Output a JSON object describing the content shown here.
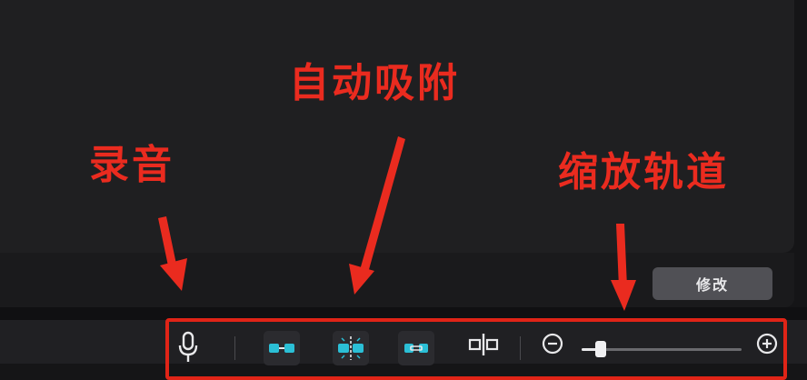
{
  "top_panel": {
    "edit_button_label": "修改"
  },
  "annotations": {
    "record": "录音",
    "auto_snap": "自动吸附",
    "zoom_track": "缩放轨道"
  },
  "toolbar": {
    "items": [
      {
        "icon": "microphone-icon",
        "label": "录音"
      },
      {
        "icon": "snap-link-icon"
      },
      {
        "icon": "auto-snap-icon",
        "active": true
      },
      {
        "icon": "linkage-icon"
      },
      {
        "icon": "split-preview-icon"
      },
      {
        "icon": "zoom-out-icon"
      },
      {
        "icon": "zoom-in-icon"
      }
    ],
    "zoom_level": 0.12
  },
  "colors": {
    "accent": "#2bbfd6",
    "annotation_red": "#ea2b1f",
    "background": "#151517"
  }
}
